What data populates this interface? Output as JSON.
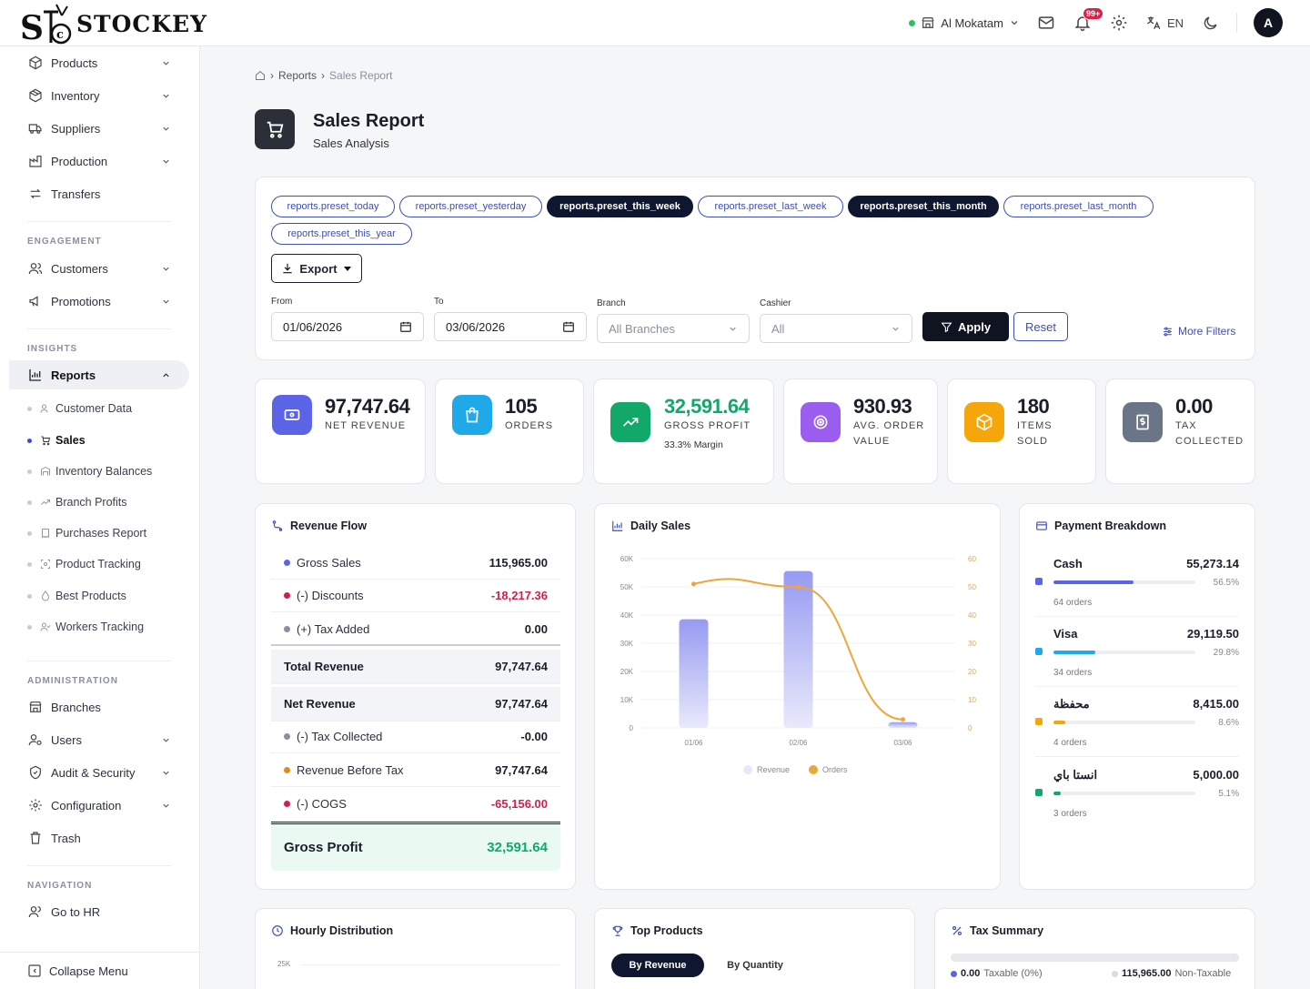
{
  "brand": {
    "name": "STOCKEY",
    "mark": "STC"
  },
  "topbar": {
    "branch": "Al Mokatam",
    "notif_badge": "99+",
    "lang": "EN",
    "avatar": "A"
  },
  "sidebar": {
    "items_top": [
      {
        "label": "Products",
        "icon": "box-icon",
        "chevron": true
      },
      {
        "label": "Inventory",
        "icon": "package-icon",
        "chevron": true
      },
      {
        "label": "Suppliers",
        "icon": "truck-icon",
        "chevron": true
      },
      {
        "label": "Production",
        "icon": "factory-icon",
        "chevron": true
      },
      {
        "label": "Transfers",
        "icon": "arrows-icon",
        "chevron": false
      }
    ],
    "engagement_label": "ENGAGEMENT",
    "engagement": [
      {
        "label": "Customers",
        "icon": "users-icon"
      },
      {
        "label": "Promotions",
        "icon": "megaphone-icon"
      }
    ],
    "insights_label": "INSIGHTS",
    "reports_label": "Reports",
    "report_subitems": [
      "Customer Data",
      "Sales",
      "Inventory Balances",
      "Branch Profits",
      "Purchases Report",
      "Product Tracking",
      "Best Products",
      "Workers Tracking"
    ],
    "administration_label": "ADMINISTRATION",
    "administration": [
      {
        "label": "Branches",
        "chevron": false
      },
      {
        "label": "Users",
        "chevron": true
      },
      {
        "label": "Audit & Security",
        "chevron": true
      },
      {
        "label": "Configuration",
        "chevron": true
      },
      {
        "label": "Trash",
        "chevron": false
      }
    ],
    "navigation_label": "NAVIGATION",
    "go_hr": "Go to HR",
    "collapse": "Collapse Menu"
  },
  "breadcrumb": {
    "parent": "Reports",
    "current": "Sales Report"
  },
  "page": {
    "title": "Sales Report",
    "subtitle": "Sales Analysis"
  },
  "filters": {
    "presets": [
      "reports.preset_today",
      "reports.preset_yesterday",
      "reports.preset_this_week",
      "reports.preset_last_week",
      "reports.preset_this_month",
      "reports.preset_last_month",
      "reports.preset_this_year"
    ],
    "export": "Export",
    "from_label": "From",
    "from_value": "01/06/2026",
    "to_label": "To",
    "to_value": "03/06/2026",
    "branch_label": "Branch",
    "branch_value": "All Branches",
    "cashier_label": "Cashier",
    "cashier_value": "All",
    "apply": "Apply",
    "reset": "Reset",
    "more": "More Filters"
  },
  "kpis": [
    {
      "value": "97,747.64",
      "label": "NET REVENUE",
      "color": "#5b63e6"
    },
    {
      "value": "105",
      "label": "ORDERS",
      "color": "#1fa9e8"
    },
    {
      "value": "32,591.64",
      "label": "GROSS PROFIT",
      "extra": "33.3% Margin",
      "color": "#12a86a"
    },
    {
      "value": "930.93",
      "label1": "AVG. ORDER",
      "label2": "VALUE",
      "color": "#9b5cf0"
    },
    {
      "value": "180",
      "label1": "ITEMS",
      "label2": "SOLD",
      "color": "#f5a60b"
    },
    {
      "value": "0.00",
      "label1": "TAX",
      "label2": "COLLECTED",
      "color": "#6b7588"
    }
  ],
  "revenue_flow": {
    "title": "Revenue Flow",
    "rows": [
      {
        "label": "Gross Sales",
        "value": "115,965.00",
        "dot": "#5b63e6"
      },
      {
        "label": "(-) Discounts",
        "value": "-18,217.36",
        "dot": "#d21f4a",
        "neg": true
      },
      {
        "label": "(+) Tax Added",
        "value": "0.00",
        "dot": "#8a90a0"
      }
    ],
    "total_revenue": {
      "label": "Total Revenue",
      "value": "97,747.64"
    },
    "net_revenue": {
      "label": "Net Revenue",
      "value": "97,747.64"
    },
    "rows2": [
      {
        "label": "(-) Tax Collected",
        "value": "-0.00",
        "dot": "#8a90a0"
      },
      {
        "label": "Revenue Before Tax",
        "value": "97,747.64",
        "dot": "#e08a1a"
      },
      {
        "label": "(-) COGS",
        "value": "-65,156.00",
        "dot": "#d21f4a",
        "neg": true
      }
    ],
    "gross_profit": {
      "label": "Gross Profit",
      "value": "32,591.64"
    }
  },
  "daily_sales": {
    "title": "Daily Sales"
  },
  "chart_data": {
    "type": "bar",
    "categories": [
      "01/06",
      "02/06",
      "03/06"
    ],
    "series": [
      {
        "name": "Revenue",
        "type": "bar",
        "values": [
          38500,
          55600,
          2000
        ],
        "color": "#9094f0"
      },
      {
        "name": "Orders",
        "type": "line",
        "values": [
          51,
          50,
          3
        ],
        "color": "#f0a53a"
      }
    ],
    "y_ticks": [
      "0",
      "10K",
      "20K",
      "30K",
      "40K",
      "50K",
      "60K"
    ],
    "y2_ticks": [
      "0",
      "10",
      "20",
      "30",
      "40",
      "50",
      "60"
    ],
    "ylim": [
      0,
      60000
    ],
    "y2lim": [
      0,
      60
    ],
    "legend": "bottom"
  },
  "payment": {
    "title": "Payment Breakdown",
    "items": [
      {
        "name": "Cash",
        "value": "55,273.14",
        "pct": "56.5%",
        "pct_num": 56.5,
        "orders": "64 orders",
        "color": "#5b63e6"
      },
      {
        "name": "Visa",
        "value": "29,119.50",
        "pct": "29.8%",
        "pct_num": 29.8,
        "orders": "34 orders",
        "color": "#1fa9e8"
      },
      {
        "name": "محفظة",
        "value": "8,415.00",
        "pct": "8.6%",
        "pct_num": 8.6,
        "orders": "4 orders",
        "color": "#f5a60b"
      },
      {
        "name": "انستا باي",
        "value": "5,000.00",
        "pct": "5.1%",
        "pct_num": 5.1,
        "orders": "3 orders",
        "color": "#12a86a"
      }
    ]
  },
  "hourly": {
    "title": "Hourly Distribution",
    "first_tick": "25K"
  },
  "top_products": {
    "title": "Top Products",
    "tab_revenue": "By Revenue",
    "tab_quantity": "By Quantity"
  },
  "tax": {
    "title": "Tax Summary",
    "taxable_value": "0.00",
    "taxable_label": "Taxable (0%)",
    "nontax_value": "115,965.00",
    "nontax_label": "Non-Taxable"
  }
}
